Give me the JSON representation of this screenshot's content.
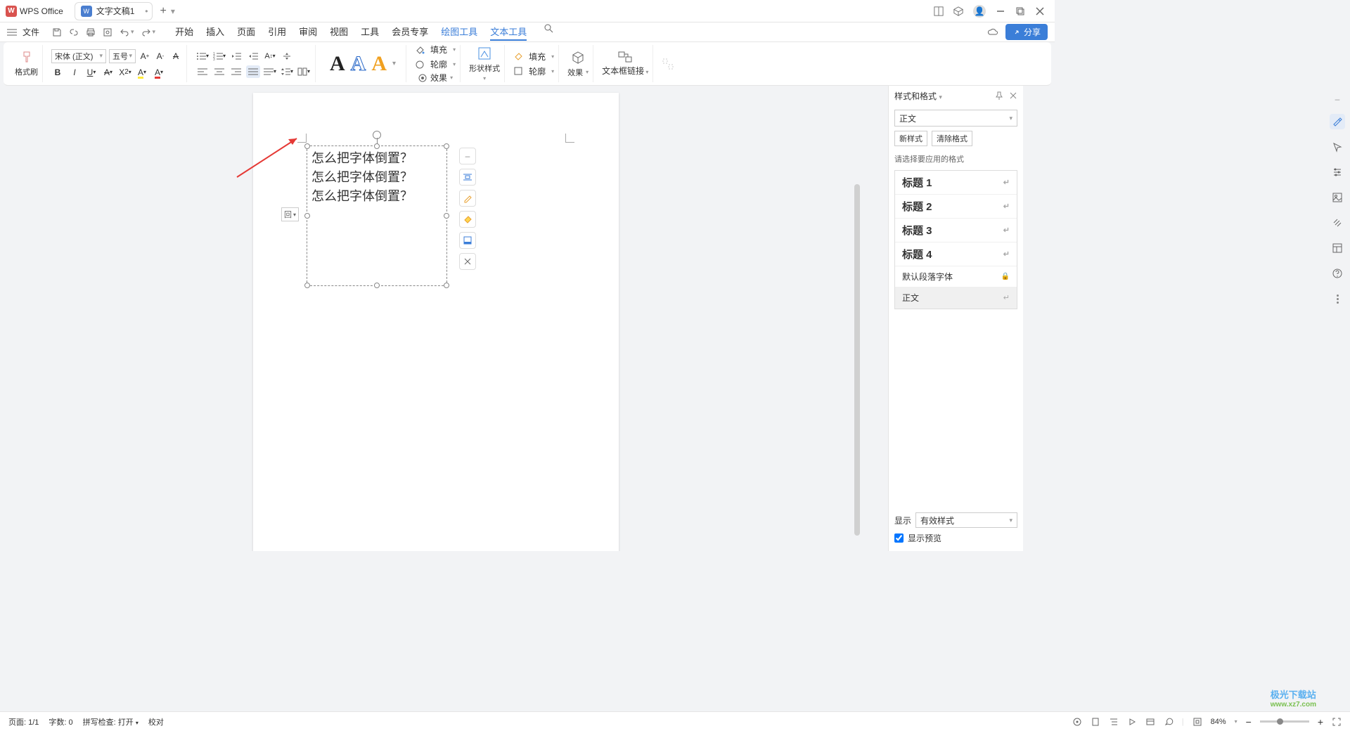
{
  "app": {
    "name": "WPS Office"
  },
  "tab": {
    "title": "文字文稿1"
  },
  "file_menu": "文件",
  "menu_tabs": {
    "start": "开始",
    "insert": "插入",
    "page": "页面",
    "ref": "引用",
    "review": "审阅",
    "view": "视图",
    "tools": "工具",
    "member": "会员专享",
    "draw": "绘图工具",
    "text": "文本工具"
  },
  "share": "分享",
  "ribbon": {
    "format_painter": "格式刷",
    "font_name": "宋体 (正文)",
    "font_size": "五号",
    "fill": "填充",
    "outline": "轮廓",
    "effect": "效果",
    "shape_style": "形状样式",
    "fill2": "填充",
    "outline2": "轮廓",
    "effect2": "效果",
    "textbox_link": "文本框链接"
  },
  "textbox_lines": [
    "怎么把字体倒置？",
    "怎么把字体倒置？",
    "怎么把字体倒置？"
  ],
  "anchor": "回",
  "side": {
    "title": "样式和格式",
    "current": "正文",
    "new_style": "新样式",
    "clear_format": "清除格式",
    "hint": "请选择要应用的格式",
    "items": {
      "h1": "标题 1",
      "h2": "标题 2",
      "h3": "标题 3",
      "h4": "标题 4",
      "default_font": "默认段落字体",
      "body": "正文"
    },
    "display_label": "显示",
    "display_value": "有效样式",
    "preview": "显示预览"
  },
  "status": {
    "page": "页面: 1/1",
    "words": "字数: 0",
    "spell": "拼写检查: 打开",
    "proof": "校对",
    "zoom": "84%"
  },
  "watermark": {
    "l1": "极光下载站",
    "l2": "www.xz7.com"
  }
}
